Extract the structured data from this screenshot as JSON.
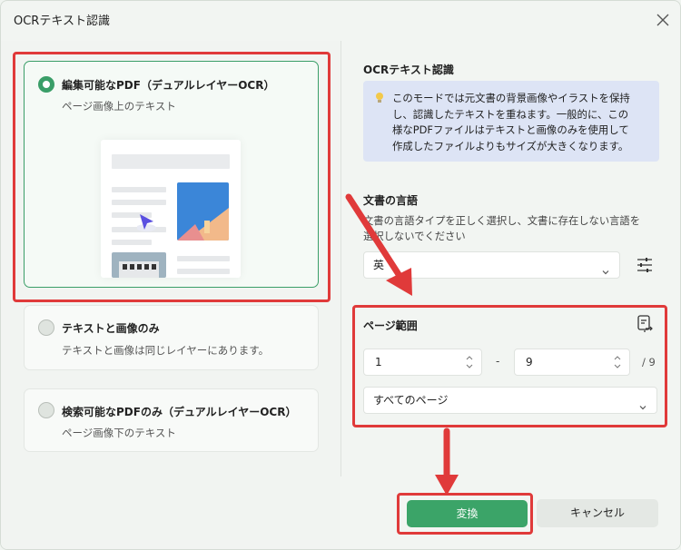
{
  "window": {
    "title": "OCRテキスト認識"
  },
  "options": [
    {
      "title": "編集可能なPDF（デュアルレイヤーOCR）",
      "subtitle": "ページ画像上のテキスト",
      "selected": true
    },
    {
      "title": "テキストと画像のみ",
      "subtitle": "テキストと画像は同じレイヤーにあります。",
      "selected": false
    },
    {
      "title": "検索可能なPDFのみ（デュアルレイヤーOCR）",
      "subtitle": "ページ画像下のテキスト",
      "selected": false
    }
  ],
  "ocr_section": {
    "title": "OCRテキスト認識",
    "info_lines": [
      "このモードでは元文書の背景画像やイラストを保持",
      "し、認識したテキストを重ねます。一般的に、この",
      "様なPDFファイルはテキストと画像のみを使用して",
      "作成したファイルよりもサイズが大きくなります。"
    ]
  },
  "language_section": {
    "title": "文書の言語",
    "desc_lines": [
      "文書の言語タイプを正しく選択し、文書に存在しない言語を",
      "選択しないでください"
    ],
    "selected_language": "英"
  },
  "page_range": {
    "title": "ページ範囲",
    "from": "1",
    "separator": "-",
    "to": "9",
    "total": "/ 9",
    "scope": "すべてのページ"
  },
  "buttons": {
    "convert": "変換",
    "cancel": "キャンセル"
  },
  "colors": {
    "accent": "#3ba468",
    "highlight": "#e03a3a",
    "info_bg": "#dde4f5"
  }
}
